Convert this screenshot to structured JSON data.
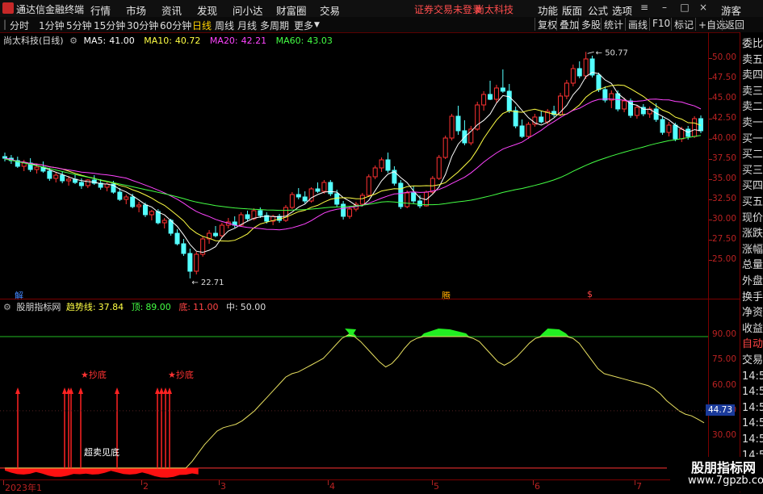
{
  "app": {
    "name": "通达信金融终端"
  },
  "menu": [
    "行情",
    "市场",
    "资讯",
    "发现",
    "问小达",
    "财富圈",
    "交易"
  ],
  "notice": "证券交易未登录",
  "stock_title": "尚太科技",
  "right_menu": [
    "功能",
    "版面",
    "公式",
    "选项"
  ],
  "guest": "游客",
  "toolbar": {
    "periods": [
      "分时",
      "1分钟",
      "5分钟",
      "15分钟",
      "30分钟",
      "60分钟",
      "日线",
      "周线",
      "月线",
      "多周期",
      "更多"
    ],
    "active": "日线",
    "right_buttons": [
      "复权",
      "叠加",
      "多股",
      "统计",
      "画线",
      "F10",
      "标记",
      "+自选",
      "返回"
    ]
  },
  "main_chart": {
    "name": "尚太科技(日线)",
    "ma": [
      {
        "label": "MA5:",
        "value": "41.00",
        "color": "#ffffff"
      },
      {
        "label": "MA10:",
        "value": "40.72",
        "color": "#ffff44"
      },
      {
        "label": "MA20:",
        "value": "42.21",
        "color": "#ff44ff"
      },
      {
        "label": "MA60:",
        "value": "43.03",
        "color": "#44ff44"
      }
    ],
    "y_ticks": [
      "50.00",
      "47.50",
      "45.00",
      "42.50",
      "40.00",
      "37.50",
      "35.00",
      "32.50",
      "30.00",
      "27.50",
      "25.00"
    ],
    "high_label": "50.77",
    "low_label": "22.71",
    "markers": [
      "解",
      "腾",
      "$"
    ]
  },
  "sub_chart": {
    "name": "股朋指标网",
    "params": [
      {
        "label": "趋势线:",
        "value": "37.84",
        "color": "#ffff44"
      },
      {
        "label": "顶:",
        "value": "89.00",
        "color": "#44ff44"
      },
      {
        "label": "底:",
        "value": "11.00",
        "color": "#ff4444"
      },
      {
        "label": "中:",
        "value": "50.00",
        "color": "#dddddd"
      }
    ],
    "y_ticks": [
      "90.00",
      "75.00",
      "60.00",
      "45.00",
      "30.00",
      "15.00"
    ],
    "current": "44.73",
    "annotations": [
      "★抄底",
      "★抄底",
      "超卖见底"
    ]
  },
  "x_axis": [
    "2023年1",
    "2",
    "3",
    "4",
    "5",
    "6",
    "7"
  ],
  "side_labels": [
    "委比",
    "卖五",
    "卖四",
    "卖三",
    "卖二",
    "卖一",
    "买一",
    "买二",
    "买三",
    "买四",
    "买五",
    "现价",
    "涨跌",
    "涨幅",
    "总量",
    "外盘",
    "换手",
    "净资",
    "收益",
    "自动",
    "交易",
    "14:56",
    "14:56",
    "14:56",
    "14:56",
    "14:56",
    "14:56",
    "14:56",
    "14:56"
  ],
  "watermark": {
    "title": "股朋指标网",
    "url": "www.7gpzb.com"
  },
  "chart_data": [
    {
      "type": "candlestick",
      "title": "尚太科技(日线)",
      "ylim": [
        22,
        52
      ],
      "candles_ohlc": [
        [
          37.8,
          38.3,
          37.2,
          37.6
        ],
        [
          37.6,
          38.0,
          36.9,
          37.3
        ],
        [
          37.3,
          37.8,
          36.4,
          36.6
        ],
        [
          36.6,
          37.4,
          36.0,
          37.0
        ],
        [
          37.0,
          37.6,
          35.9,
          36.2
        ],
        [
          36.2,
          36.9,
          35.7,
          36.5
        ],
        [
          36.5,
          37.2,
          35.8,
          36.0
        ],
        [
          36.0,
          36.4,
          34.8,
          35.1
        ],
        [
          35.1,
          35.8,
          34.6,
          35.5
        ],
        [
          35.5,
          36.0,
          34.5,
          34.8
        ],
        [
          34.8,
          35.4,
          34.2,
          35.0
        ],
        [
          35.0,
          35.6,
          34.4,
          34.6
        ],
        [
          34.6,
          35.1,
          33.8,
          34.2
        ],
        [
          34.2,
          35.0,
          33.9,
          34.9
        ],
        [
          34.9,
          35.5,
          34.3,
          34.5
        ],
        [
          34.5,
          35.0,
          33.7,
          34.0
        ],
        [
          34.0,
          34.6,
          33.5,
          34.4
        ],
        [
          34.4,
          34.8,
          33.2,
          33.4
        ],
        [
          33.4,
          33.9,
          32.3,
          32.5
        ],
        [
          32.5,
          33.1,
          31.9,
          32.8
        ],
        [
          32.8,
          33.2,
          31.4,
          31.6
        ],
        [
          31.6,
          32.2,
          30.9,
          31.8
        ],
        [
          31.8,
          32.1,
          30.3,
          30.6
        ],
        [
          30.6,
          31.2,
          29.9,
          31.0
        ],
        [
          31.0,
          31.3,
          29.4,
          29.6
        ],
        [
          29.6,
          30.2,
          28.9,
          29.9
        ],
        [
          29.9,
          30.1,
          28.0,
          28.3
        ],
        [
          28.3,
          28.8,
          26.8,
          27.0
        ],
        [
          27.0,
          27.6,
          25.5,
          25.8
        ],
        [
          25.8,
          26.4,
          22.71,
          23.6
        ],
        [
          23.6,
          26.0,
          23.2,
          25.7
        ],
        [
          25.7,
          27.9,
          25.4,
          27.6
        ],
        [
          27.6,
          28.7,
          27.0,
          28.3
        ],
        [
          28.3,
          29.2,
          27.8,
          28.0
        ],
        [
          28.0,
          29.6,
          27.7,
          29.3
        ],
        [
          29.3,
          30.2,
          28.9,
          29.7
        ],
        [
          29.7,
          30.4,
          29.0,
          29.3
        ],
        [
          29.3,
          30.9,
          29.1,
          30.6
        ],
        [
          30.6,
          31.1,
          29.8,
          30.1
        ],
        [
          30.1,
          31.4,
          29.9,
          31.1
        ],
        [
          31.1,
          31.5,
          30.2,
          30.5
        ],
        [
          30.5,
          30.9,
          29.5,
          29.8
        ],
        [
          29.8,
          30.6,
          29.3,
          30.4
        ],
        [
          30.4,
          30.7,
          29.6,
          29.9
        ],
        [
          29.9,
          31.8,
          29.7,
          31.5
        ],
        [
          31.5,
          33.4,
          31.3,
          33.1
        ],
        [
          33.1,
          33.9,
          32.5,
          32.8
        ],
        [
          32.8,
          33.5,
          32.0,
          32.3
        ],
        [
          32.3,
          34.0,
          32.1,
          33.8
        ],
        [
          33.8,
          34.6,
          33.3,
          33.5
        ],
        [
          33.5,
          34.9,
          33.2,
          34.6
        ],
        [
          34.6,
          34.9,
          32.9,
          33.2
        ],
        [
          33.2,
          33.7,
          31.6,
          31.9
        ],
        [
          31.9,
          32.3,
          30.0,
          30.4
        ],
        [
          30.4,
          31.6,
          30.1,
          31.3
        ],
        [
          31.3,
          32.2,
          31.0,
          31.9
        ],
        [
          31.9,
          33.3,
          31.7,
          33.0
        ],
        [
          33.0,
          35.6,
          32.8,
          35.3
        ],
        [
          35.3,
          36.7,
          35.0,
          36.4
        ],
        [
          36.4,
          37.7,
          35.9,
          37.4
        ],
        [
          37.4,
          38.3,
          35.8,
          36.1
        ],
        [
          36.1,
          36.6,
          34.2,
          34.5
        ],
        [
          34.5,
          34.9,
          31.3,
          31.6
        ],
        [
          31.6,
          33.6,
          31.4,
          33.3
        ],
        [
          33.3,
          34.1,
          32.0,
          32.3
        ],
        [
          32.3,
          33.0,
          31.4,
          31.7
        ],
        [
          31.7,
          33.6,
          31.6,
          33.4
        ],
        [
          33.4,
          35.4,
          33.2,
          35.1
        ],
        [
          35.1,
          38.0,
          34.9,
          37.7
        ],
        [
          37.7,
          40.4,
          37.5,
          40.1
        ],
        [
          40.1,
          43.1,
          39.8,
          42.8
        ],
        [
          42.8,
          44.1,
          40.5,
          41.0
        ],
        [
          41.0,
          42.3,
          39.2,
          39.5
        ],
        [
          39.5,
          41.6,
          39.2,
          41.2
        ],
        [
          41.2,
          44.6,
          41.0,
          44.2
        ],
        [
          44.2,
          45.9,
          43.5,
          45.5
        ],
        [
          45.5,
          47.2,
          44.8,
          44.9
        ],
        [
          44.9,
          46.7,
          44.5,
          46.3
        ],
        [
          46.3,
          48.6,
          45.7,
          45.9
        ],
        [
          45.9,
          46.8,
          43.2,
          43.5
        ],
        [
          43.5,
          44.0,
          41.3,
          41.6
        ],
        [
          41.6,
          42.4,
          40.1,
          40.3
        ],
        [
          40.3,
          42.1,
          40.0,
          41.8
        ],
        [
          41.8,
          43.1,
          41.5,
          42.7
        ],
        [
          42.7,
          43.4,
          41.9,
          42.1
        ],
        [
          42.1,
          43.7,
          41.8,
          43.4
        ],
        [
          43.4,
          44.1,
          42.7,
          43.0
        ],
        [
          43.0,
          45.7,
          42.8,
          45.3
        ],
        [
          45.3,
          47.3,
          44.9,
          46.9
        ],
        [
          46.9,
          49.2,
          46.5,
          48.7
        ],
        [
          48.7,
          49.6,
          47.5,
          47.8
        ],
        [
          47.8,
          50.77,
          47.4,
          49.9
        ],
        [
          49.9,
          50.3,
          47.6,
          47.9
        ],
        [
          47.9,
          48.2,
          45.8,
          46.1
        ],
        [
          46.1,
          46.5,
          44.5,
          44.8
        ],
        [
          44.8,
          46.0,
          43.8,
          45.6
        ],
        [
          45.6,
          46.0,
          43.4,
          43.7
        ],
        [
          43.7,
          45.1,
          43.3,
          44.7
        ],
        [
          44.7,
          45.0,
          42.6,
          42.9
        ],
        [
          42.9,
          44.2,
          42.5,
          43.9
        ],
        [
          43.9,
          44.3,
          42.8,
          43.1
        ],
        [
          43.1,
          44.0,
          42.6,
          43.7
        ],
        [
          43.7,
          44.4,
          42.1,
          42.4
        ],
        [
          42.4,
          42.8,
          40.5,
          40.8
        ],
        [
          40.8,
          42.1,
          40.3,
          41.7
        ],
        [
          41.7,
          42.0,
          39.7,
          40.0
        ],
        [
          40.0,
          41.5,
          39.6,
          41.2
        ],
        [
          41.2,
          41.6,
          39.9,
          40.3
        ],
        [
          40.3,
          42.8,
          40.1,
          42.5
        ],
        [
          42.5,
          42.9,
          40.7,
          41.0
        ]
      ],
      "ma_series": [
        "MA5",
        "MA10",
        "MA20",
        "MA60"
      ]
    },
    {
      "type": "line",
      "title": "股朋指标网",
      "ylim": [
        10,
        100
      ],
      "series": [
        {
          "name": "趋势线",
          "values": [
            11,
            11,
            11,
            11,
            11,
            11,
            11,
            11,
            11,
            11,
            11,
            11,
            11,
            11,
            11,
            11,
            11,
            11,
            11,
            11,
            11,
            11,
            11,
            11,
            11,
            11,
            11,
            11,
            11,
            11,
            15,
            20,
            25,
            29,
            33,
            35,
            36,
            37,
            39,
            42,
            45,
            49,
            53,
            57,
            61,
            65,
            67,
            68,
            70,
            72,
            74,
            76,
            80,
            84,
            88,
            90,
            89,
            86,
            82,
            78,
            74,
            71,
            73,
            77,
            82,
            86,
            88,
            89,
            89,
            89,
            89,
            89,
            89,
            89,
            89,
            88,
            86,
            82,
            78,
            74,
            72,
            74,
            77,
            81,
            85,
            88,
            89,
            89,
            89,
            89,
            89,
            88,
            85,
            80,
            75,
            70,
            67,
            66,
            65,
            64,
            63,
            62,
            61,
            60,
            58,
            55,
            51,
            48,
            45,
            43,
            42,
            40,
            37.84
          ]
        }
      ],
      "levels": {
        "顶": 89,
        "底": 11,
        "中": 50
      },
      "current_label": 44.73
    }
  ]
}
